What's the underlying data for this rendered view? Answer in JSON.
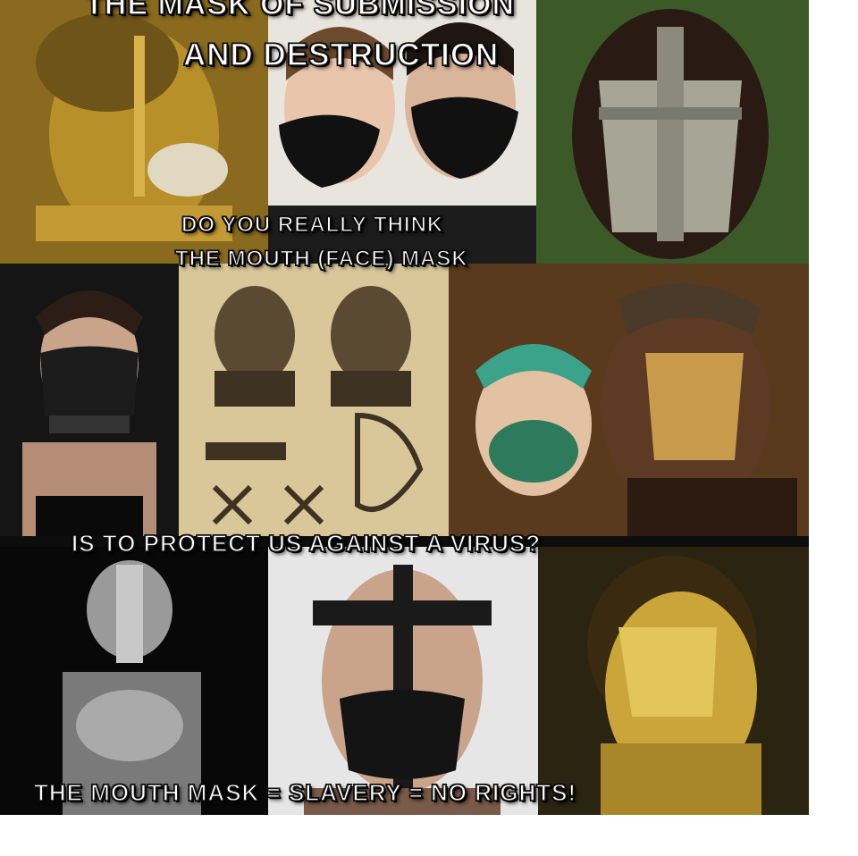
{
  "title": {
    "line1": "THE MASK OF SUBMISSION",
    "line2": "AND DESTRUCTION"
  },
  "question": {
    "line1": "DO YOU REALLY THINK",
    "line2": "THE MOUTH (FACE) MASK",
    "line3": "IS TO PROTECT US AGAINST A VIRUS?"
  },
  "verdict": "THE MOUTH MASK = SLAVERY = NO RIGHTS!",
  "colors": {
    "gold": "#b8902a",
    "dark_bg": "#0d0d0d",
    "cloth_mask": "#111111",
    "parchment": "#d9c79a",
    "caption_text": "#ffffff"
  }
}
